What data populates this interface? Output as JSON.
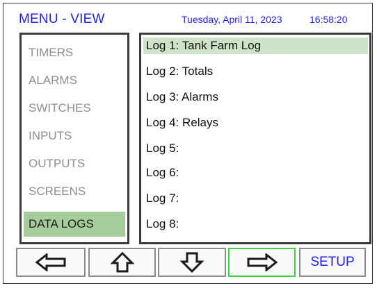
{
  "header": {
    "title": "MENU - VIEW",
    "date": "Tuesday, April 11, 2023",
    "time": "16:58:20"
  },
  "sidebar": {
    "items": [
      {
        "label": "TIMERS",
        "active": false
      },
      {
        "label": "ALARMS",
        "active": false
      },
      {
        "label": "SWITCHES",
        "active": false
      },
      {
        "label": "INPUTS",
        "active": false
      },
      {
        "label": "OUTPUTS",
        "active": false
      },
      {
        "label": "SCREENS",
        "active": false
      },
      {
        "label": "DATA LOGS",
        "active": true
      }
    ]
  },
  "logs": {
    "items": [
      {
        "label": "Log 1: Tank Farm Log",
        "selected": true
      },
      {
        "label": "Log 2: Totals",
        "selected": false
      },
      {
        "label": "Log 3: Alarms",
        "selected": false
      },
      {
        "label": "Log 4: Relays",
        "selected": false
      },
      {
        "label": "Log 5:",
        "selected": false
      },
      {
        "label": "Log 6:",
        "selected": false
      },
      {
        "label": "Log 7:",
        "selected": false
      },
      {
        "label": "Log 8:",
        "selected": false
      }
    ]
  },
  "buttons": {
    "left_icon": "arrow-left-icon",
    "up_icon": "arrow-up-icon",
    "down_icon": "arrow-down-icon",
    "right_icon": "arrow-right-icon",
    "setup_label": "SETUP"
  },
  "colors": {
    "accent_text": "#1f1ff0",
    "active_item_bg": "#a7cc9b",
    "selected_row_bg": "#cfe3c9",
    "focus_border": "#3fd13f"
  }
}
